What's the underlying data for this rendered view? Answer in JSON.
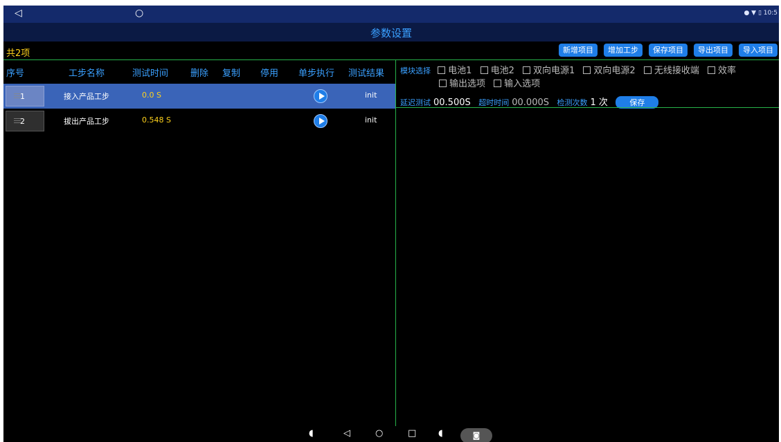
{
  "status_bar": {
    "back": "◁",
    "home": "○",
    "time": "10:5"
  },
  "title": "参数设置",
  "count_label": "共2项",
  "toolbar": {
    "buttons": [
      "新增项目",
      "增加工步",
      "保存项目",
      "导出项目",
      "导入项目"
    ]
  },
  "table": {
    "headers": [
      "序号",
      "工步名称",
      "测试时间",
      "删除",
      "复制",
      "停用",
      "单步执行",
      "测试结果"
    ],
    "rows": [
      {
        "num": "1",
        "name": "接入产品工步",
        "time": "0.0 S",
        "result": "init",
        "selected": true
      },
      {
        "num": "2",
        "name": "拔出产品工步",
        "time": "0.548 S",
        "result": "init",
        "selected": false
      }
    ]
  },
  "module": {
    "label": "模块选择",
    "options": [
      "电池1",
      "电池2",
      "双向电源1",
      "双向电源2",
      "无线接收端",
      "效率",
      "输出选项",
      "输入选项"
    ]
  },
  "params": {
    "delay_label": "延迟测试",
    "delay_value": "00.500S",
    "timeout_label": "超时时间",
    "timeout_value": "00.000S",
    "count_label": "检测次数",
    "count_value": "1 次",
    "save": "保存"
  },
  "colors": {
    "accent": "#1f7ee8",
    "highlight": "#ffd21c",
    "divider": "#27b34a",
    "title_bg": "#0b1a44"
  }
}
